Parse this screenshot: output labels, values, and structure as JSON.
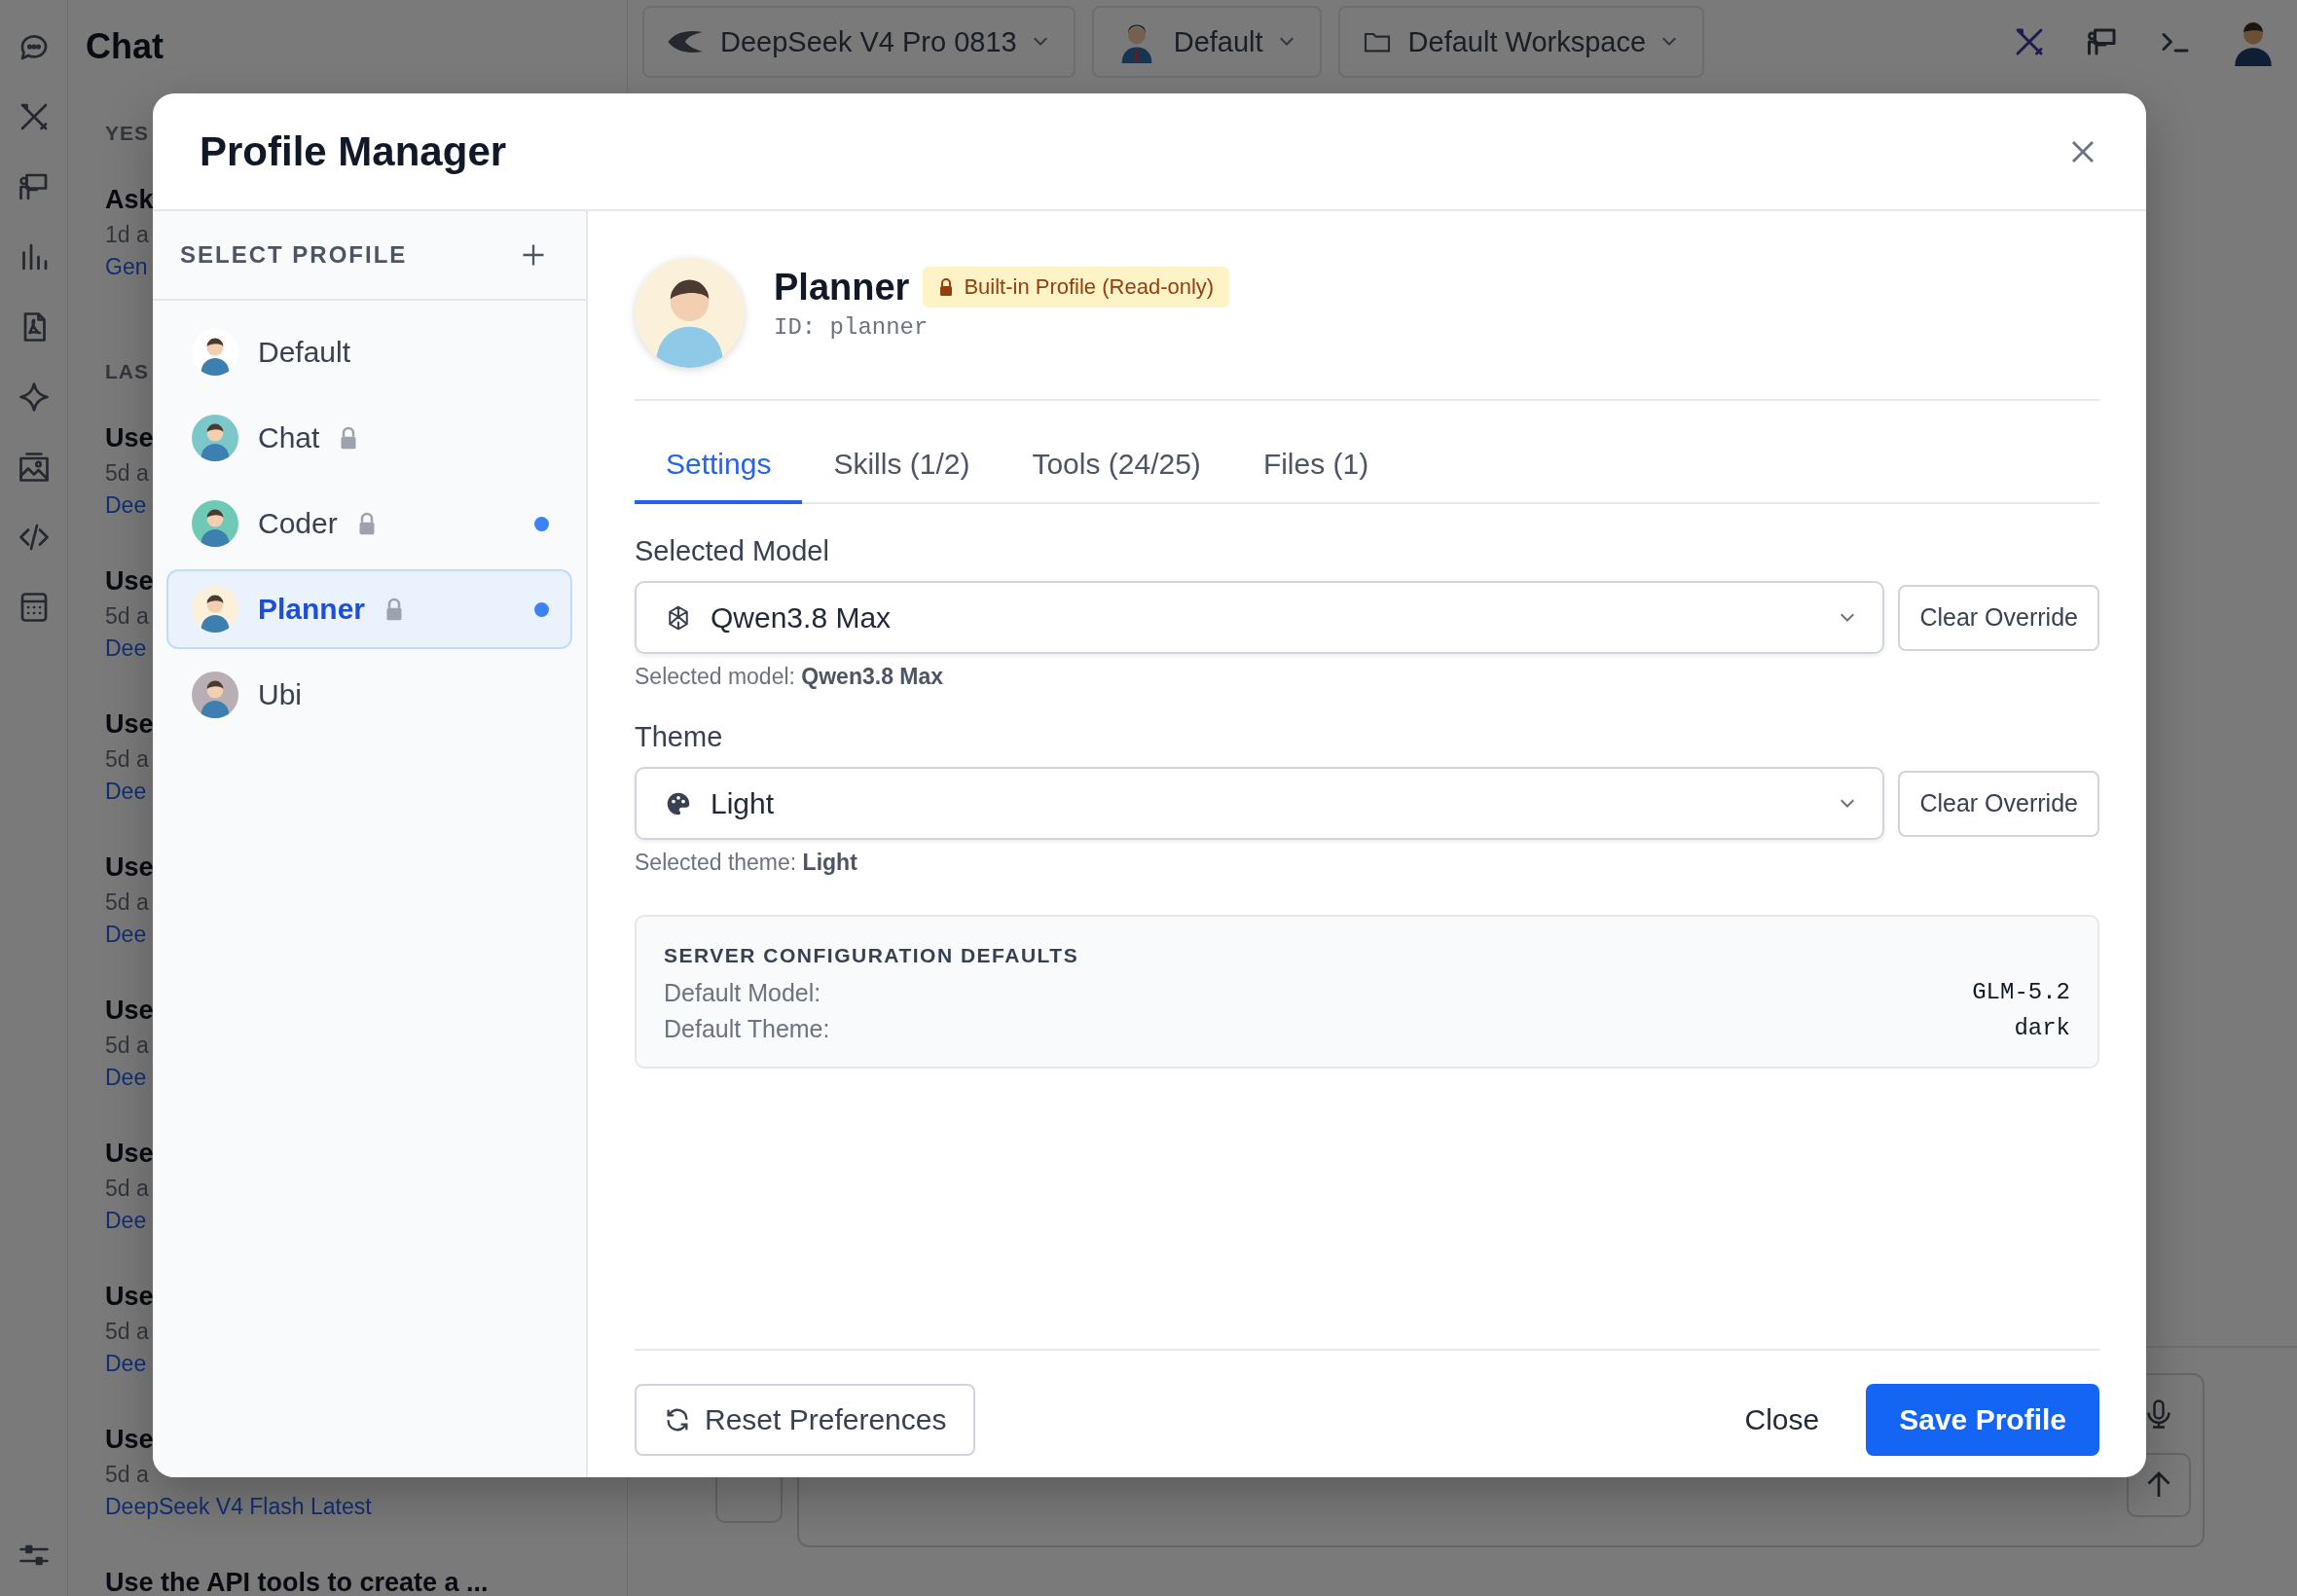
{
  "chat_list": {
    "title": "Chat",
    "sections": [
      {
        "label": "YES",
        "items": [
          {
            "title": "Ask",
            "time": "1d a",
            "model": "Gen"
          }
        ]
      },
      {
        "label": "LAS",
        "items": [
          {
            "title": "Use",
            "time": "5d a",
            "model": "Dee"
          },
          {
            "title": "Use",
            "time": "5d a",
            "model": "Dee"
          },
          {
            "title": "Use",
            "time": "5d a",
            "model": "Dee"
          },
          {
            "title": "Use",
            "time": "5d a",
            "model": "Dee"
          },
          {
            "title": "Use",
            "time": "5d a",
            "model": "Dee"
          },
          {
            "title": "Use",
            "time": "5d a",
            "model": "Dee"
          },
          {
            "title": "Use",
            "time": "5d a",
            "model": "Dee"
          },
          {
            "title": "Use",
            "time": "5d a",
            "model": "DeepSeek V4 Flash Latest"
          },
          {
            "title": "Use the API tools to create a ..."
          }
        ]
      }
    ]
  },
  "top_bar": {
    "model_selector": "DeepSeek V4 Pro 0813",
    "profile_selector": "Default",
    "workspace_selector": "Default Workspace"
  },
  "modal": {
    "title": "Profile Manager",
    "sidebar_heading": "SELECT PROFILE",
    "profiles": [
      {
        "name": "Default",
        "locked": false,
        "indicator": false,
        "selected": false,
        "color": "#ffffff"
      },
      {
        "name": "Chat",
        "locked": true,
        "indicator": false,
        "selected": false,
        "color": "#7cc7c9"
      },
      {
        "name": "Coder",
        "locked": true,
        "indicator": true,
        "selected": false,
        "color": "#6fcab5"
      },
      {
        "name": "Planner",
        "locked": true,
        "indicator": true,
        "selected": true,
        "color": "#fbf0d9"
      },
      {
        "name": "Ubi",
        "locked": false,
        "indicator": false,
        "selected": false,
        "color": "#b9aeb4"
      }
    ],
    "profile": {
      "name": "Planner",
      "badge": "Built-in Profile (Read-only)",
      "id": "ID: planner"
    },
    "tabs": [
      {
        "label": "Settings",
        "selected": true
      },
      {
        "label": "Skills (1/2)",
        "selected": false
      },
      {
        "label": "Tools (24/25)",
        "selected": false
      },
      {
        "label": "Files (1)",
        "selected": false
      }
    ],
    "fields": [
      {
        "kind": "model",
        "label": "Selected Model",
        "value": "Qwen3.8 Max",
        "action": "Clear Override",
        "helper": "Selected model: **Qwen3.8 Max**"
      },
      {
        "kind": "theme",
        "label": "Theme",
        "value": "Light",
        "action": "Clear Override",
        "helper": "Selected theme: **Light**"
      }
    ],
    "server_defaults": {
      "title": "SERVER CONFIGURATION DEFAULTS",
      "rows": [
        {
          "label": "Default Model:",
          "value": "GLM-5.2"
        },
        {
          "label": "Default Theme:",
          "value": "dark"
        }
      ]
    },
    "footer": {
      "reset": "Reset Preferences",
      "close": "Close",
      "save": "Save Profile"
    }
  }
}
